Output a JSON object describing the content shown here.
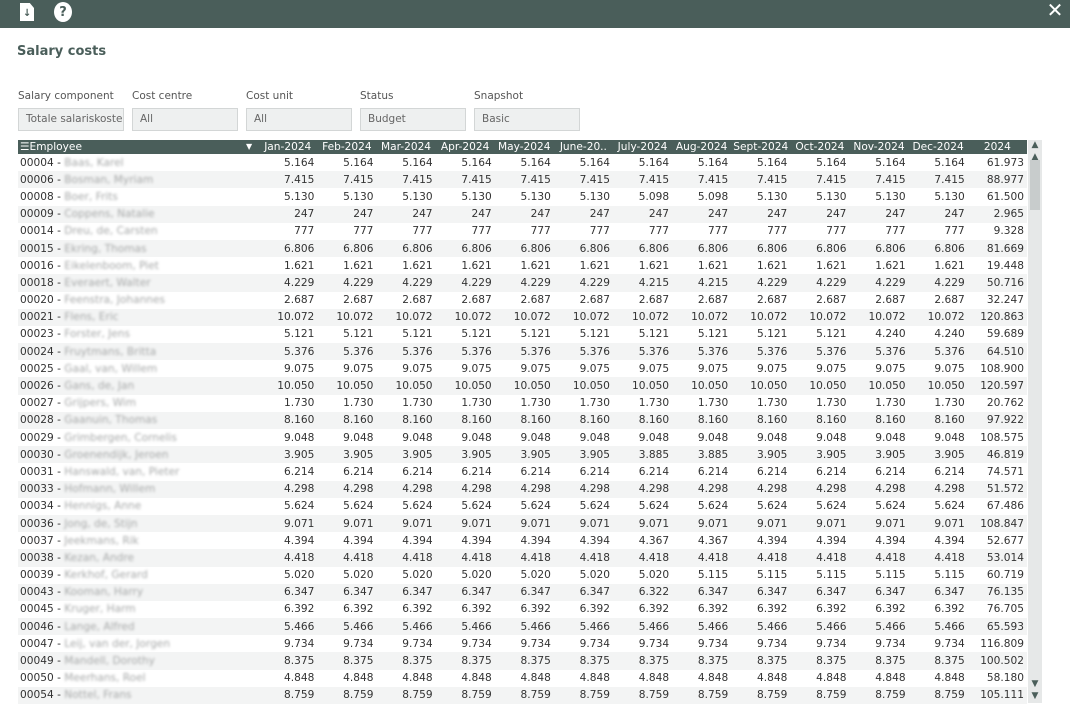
{
  "page": {
    "title": "Salary costs"
  },
  "filters": [
    {
      "label": "Salary component",
      "value": "Totale salariskoste"
    },
    {
      "label": "Cost centre",
      "value": "All"
    },
    {
      "label": "Cost unit",
      "value": "All"
    },
    {
      "label": "Status",
      "value": "Budget"
    },
    {
      "label": "Snapshot",
      "value": "Basic"
    }
  ],
  "table": {
    "employee_header": "Employee",
    "month_headers": [
      "Jan-2024",
      "Feb-2024",
      "Mar-2024",
      "Apr-2024",
      "May-2024",
      "June-20..",
      "July-2024",
      "Aug-2024",
      "Sept-2024",
      "Oct-2024",
      "Nov-2024",
      "Dec-2024",
      "2024"
    ],
    "rows": [
      {
        "id": "00004 - ",
        "name": "Baas, Karel",
        "v": [
          "5.164",
          "5.164",
          "5.164",
          "5.164",
          "5.164",
          "5.164",
          "5.164",
          "5.164",
          "5.164",
          "5.164",
          "5.164",
          "5.164",
          "61.973"
        ]
      },
      {
        "id": "00006 - ",
        "name": "Bosman, Myriam",
        "v": [
          "7.415",
          "7.415",
          "7.415",
          "7.415",
          "7.415",
          "7.415",
          "7.415",
          "7.415",
          "7.415",
          "7.415",
          "7.415",
          "7.415",
          "88.977"
        ]
      },
      {
        "id": "00008 - ",
        "name": "Boer, Frits",
        "v": [
          "5.130",
          "5.130",
          "5.130",
          "5.130",
          "5.130",
          "5.130",
          "5.098",
          "5.098",
          "5.130",
          "5.130",
          "5.130",
          "5.130",
          "61.500"
        ]
      },
      {
        "id": "00009 - ",
        "name": "Coppens, Natalie",
        "v": [
          "247",
          "247",
          "247",
          "247",
          "247",
          "247",
          "247",
          "247",
          "247",
          "247",
          "247",
          "247",
          "2.965"
        ]
      },
      {
        "id": "00014 - ",
        "name": "Dreu, de, Carsten",
        "v": [
          "777",
          "777",
          "777",
          "777",
          "777",
          "777",
          "777",
          "777",
          "777",
          "777",
          "777",
          "777",
          "9.328"
        ]
      },
      {
        "id": "00015 - ",
        "name": "Ekring, Thomas",
        "v": [
          "6.806",
          "6.806",
          "6.806",
          "6.806",
          "6.806",
          "6.806",
          "6.806",
          "6.806",
          "6.806",
          "6.806",
          "6.806",
          "6.806",
          "81.669"
        ]
      },
      {
        "id": "00016 - ",
        "name": "Eikelenboom, Piet",
        "v": [
          "1.621",
          "1.621",
          "1.621",
          "1.621",
          "1.621",
          "1.621",
          "1.621",
          "1.621",
          "1.621",
          "1.621",
          "1.621",
          "1.621",
          "19.448"
        ]
      },
      {
        "id": "00018 - ",
        "name": "Everaert, Walter",
        "v": [
          "4.229",
          "4.229",
          "4.229",
          "4.229",
          "4.229",
          "4.229",
          "4.215",
          "4.215",
          "4.229",
          "4.229",
          "4.229",
          "4.229",
          "50.716"
        ]
      },
      {
        "id": "00020 - ",
        "name": "Feenstra, Johannes",
        "v": [
          "2.687",
          "2.687",
          "2.687",
          "2.687",
          "2.687",
          "2.687",
          "2.687",
          "2.687",
          "2.687",
          "2.687",
          "2.687",
          "2.687",
          "32.247"
        ]
      },
      {
        "id": "00021 - ",
        "name": "Flens, Eric",
        "v": [
          "10.072",
          "10.072",
          "10.072",
          "10.072",
          "10.072",
          "10.072",
          "10.072",
          "10.072",
          "10.072",
          "10.072",
          "10.072",
          "10.072",
          "120.863"
        ]
      },
      {
        "id": "00023 - ",
        "name": "Forster, Jens",
        "v": [
          "5.121",
          "5.121",
          "5.121",
          "5.121",
          "5.121",
          "5.121",
          "5.121",
          "5.121",
          "5.121",
          "5.121",
          "4.240",
          "4.240",
          "59.689"
        ]
      },
      {
        "id": "00024 - ",
        "name": "Fruytmans, Britta",
        "v": [
          "5.376",
          "5.376",
          "5.376",
          "5.376",
          "5.376",
          "5.376",
          "5.376",
          "5.376",
          "5.376",
          "5.376",
          "5.376",
          "5.376",
          "64.510"
        ]
      },
      {
        "id": "00025 - ",
        "name": "Gaal, van, Willem",
        "v": [
          "9.075",
          "9.075",
          "9.075",
          "9.075",
          "9.075",
          "9.075",
          "9.075",
          "9.075",
          "9.075",
          "9.075",
          "9.075",
          "9.075",
          "108.900"
        ]
      },
      {
        "id": "00026 - ",
        "name": "Gans, de, Jan",
        "v": [
          "10.050",
          "10.050",
          "10.050",
          "10.050",
          "10.050",
          "10.050",
          "10.050",
          "10.050",
          "10.050",
          "10.050",
          "10.050",
          "10.050",
          "120.597"
        ]
      },
      {
        "id": "00027 - ",
        "name": "Grijpers, Wim",
        "v": [
          "1.730",
          "1.730",
          "1.730",
          "1.730",
          "1.730",
          "1.730",
          "1.730",
          "1.730",
          "1.730",
          "1.730",
          "1.730",
          "1.730",
          "20.762"
        ]
      },
      {
        "id": "00028 - ",
        "name": "Gaanuin, Thomas",
        "v": [
          "8.160",
          "8.160",
          "8.160",
          "8.160",
          "8.160",
          "8.160",
          "8.160",
          "8.160",
          "8.160",
          "8.160",
          "8.160",
          "8.160",
          "97.922"
        ]
      },
      {
        "id": "00029 - ",
        "name": "Grimbergen, Cornelis",
        "v": [
          "9.048",
          "9.048",
          "9.048",
          "9.048",
          "9.048",
          "9.048",
          "9.048",
          "9.048",
          "9.048",
          "9.048",
          "9.048",
          "9.048",
          "108.575"
        ]
      },
      {
        "id": "00030 - ",
        "name": "Groenendijk, Jeroen",
        "v": [
          "3.905",
          "3.905",
          "3.905",
          "3.905",
          "3.905",
          "3.905",
          "3.885",
          "3.885",
          "3.905",
          "3.905",
          "3.905",
          "3.905",
          "46.819"
        ]
      },
      {
        "id": "00031 - ",
        "name": "Hanswald, van, Pieter",
        "v": [
          "6.214",
          "6.214",
          "6.214",
          "6.214",
          "6.214",
          "6.214",
          "6.214",
          "6.214",
          "6.214",
          "6.214",
          "6.214",
          "6.214",
          "74.571"
        ]
      },
      {
        "id": "00033 - ",
        "name": "Hofmann, Willem",
        "v": [
          "4.298",
          "4.298",
          "4.298",
          "4.298",
          "4.298",
          "4.298",
          "4.298",
          "4.298",
          "4.298",
          "4.298",
          "4.298",
          "4.298",
          "51.572"
        ]
      },
      {
        "id": "00034 - ",
        "name": "Hennigs, Anne",
        "v": [
          "5.624",
          "5.624",
          "5.624",
          "5.624",
          "5.624",
          "5.624",
          "5.624",
          "5.624",
          "5.624",
          "5.624",
          "5.624",
          "5.624",
          "67.486"
        ]
      },
      {
        "id": "00036 - ",
        "name": "Jong, de, Stijn",
        "v": [
          "9.071",
          "9.071",
          "9.071",
          "9.071",
          "9.071",
          "9.071",
          "9.071",
          "9.071",
          "9.071",
          "9.071",
          "9.071",
          "9.071",
          "108.847"
        ]
      },
      {
        "id": "00037 - ",
        "name": "Jeekmans, Rik",
        "v": [
          "4.394",
          "4.394",
          "4.394",
          "4.394",
          "4.394",
          "4.394",
          "4.367",
          "4.367",
          "4.394",
          "4.394",
          "4.394",
          "4.394",
          "52.677"
        ]
      },
      {
        "id": "00038 - ",
        "name": "Kezan, Andre",
        "v": [
          "4.418",
          "4.418",
          "4.418",
          "4.418",
          "4.418",
          "4.418",
          "4.418",
          "4.418",
          "4.418",
          "4.418",
          "4.418",
          "4.418",
          "53.014"
        ]
      },
      {
        "id": "00039 - ",
        "name": "Kerkhof, Gerard",
        "v": [
          "5.020",
          "5.020",
          "5.020",
          "5.020",
          "5.020",
          "5.020",
          "5.020",
          "5.115",
          "5.115",
          "5.115",
          "5.115",
          "5.115",
          "60.719"
        ]
      },
      {
        "id": "00043 - ",
        "name": "Kooman, Harry",
        "v": [
          "6.347",
          "6.347",
          "6.347",
          "6.347",
          "6.347",
          "6.347",
          "6.322",
          "6.347",
          "6.347",
          "6.347",
          "6.347",
          "6.347",
          "76.135"
        ]
      },
      {
        "id": "00045 - ",
        "name": "Kruger, Harm",
        "v": [
          "6.392",
          "6.392",
          "6.392",
          "6.392",
          "6.392",
          "6.392",
          "6.392",
          "6.392",
          "6.392",
          "6.392",
          "6.392",
          "6.392",
          "76.705"
        ]
      },
      {
        "id": "00046 - ",
        "name": "Lange, Alfred",
        "v": [
          "5.466",
          "5.466",
          "5.466",
          "5.466",
          "5.466",
          "5.466",
          "5.466",
          "5.466",
          "5.466",
          "5.466",
          "5.466",
          "5.466",
          "65.593"
        ]
      },
      {
        "id": "00047 - ",
        "name": "Leij, van der, Jorgen",
        "v": [
          "9.734",
          "9.734",
          "9.734",
          "9.734",
          "9.734",
          "9.734",
          "9.734",
          "9.734",
          "9.734",
          "9.734",
          "9.734",
          "9.734",
          "116.809"
        ]
      },
      {
        "id": "00049 - ",
        "name": "Mandell, Dorothy",
        "v": [
          "8.375",
          "8.375",
          "8.375",
          "8.375",
          "8.375",
          "8.375",
          "8.375",
          "8.375",
          "8.375",
          "8.375",
          "8.375",
          "8.375",
          "100.502"
        ]
      },
      {
        "id": "00050 - ",
        "name": "Meerhans, Roel",
        "v": [
          "4.848",
          "4.848",
          "4.848",
          "4.848",
          "4.848",
          "4.848",
          "4.848",
          "4.848",
          "4.848",
          "4.848",
          "4.848",
          "4.848",
          "58.180"
        ]
      },
      {
        "id": "00054 - ",
        "name": "Nottel, Frans",
        "v": [
          "8.759",
          "8.759",
          "8.759",
          "8.759",
          "8.759",
          "8.759",
          "8.759",
          "8.759",
          "8.759",
          "8.759",
          "8.759",
          "8.759",
          "105.111"
        ]
      }
    ]
  },
  "colors": {
    "header_bg": "#4a5e5a",
    "stripe": "#f3f4f4"
  },
  "icons": [
    "document-download-icon",
    "help-icon",
    "close-icon",
    "menu-icon",
    "caret-down-icon",
    "scroll-up-icon",
    "scroll-down-icon"
  ]
}
